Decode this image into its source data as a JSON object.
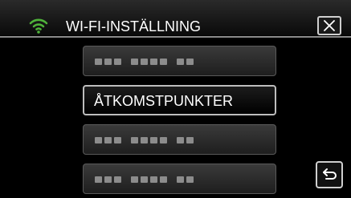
{
  "header": {
    "title": "WI-FI-INSTÄLLNING",
    "wifi_icon": "wifi-icon",
    "close_icon": "close-icon"
  },
  "menu": {
    "items": [
      {
        "label": "",
        "state": "obscured-placeholder-dots"
      },
      {
        "label": "ÅTKOMSTPUNKTER",
        "state": "selected"
      },
      {
        "label": "",
        "state": "obscured-placeholder-dots"
      },
      {
        "label": "",
        "state": "obscured-placeholder-dots"
      }
    ]
  },
  "footer": {
    "back_icon": "return-arrow-icon"
  },
  "colors": {
    "background": "#000000",
    "wifi_accent": "#4fb33a",
    "text": "#ffffff",
    "button_border": "#cfcfcf"
  }
}
